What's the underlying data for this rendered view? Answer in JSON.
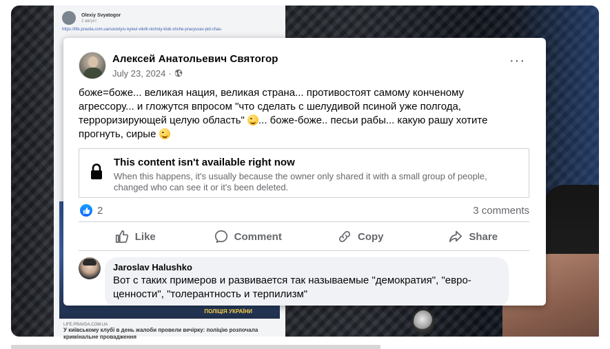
{
  "background": {
    "author": "Olexiy Svyatogor",
    "date": "2 август",
    "link": "https://life.pravda.com.ua/society/u-kyievi-vikrili-nichniy-klub-shche-pracyuvav-pid-chas-",
    "image_badge": "ПОЛІЦІЯ УКРАЇНИ",
    "source": "LIFE.PRAVDA.COM.UA",
    "caption": "У київському клубі в день жалоби провели вечірку: поліцію розпочала кримінальне провадження"
  },
  "post": {
    "author_name": "Алексей Анатольевич Святогор",
    "date": "July 23, 2024",
    "more_icon": "···",
    "text_part1": "боже=боже... великая нация, великая страна... противостоят самому конченому агрессору... и гложутся впросом \"что сделать с шелудивой псиной уже полгода, терроризирующей целую область\" ",
    "text_part2": "... боже-боже.. песьи рабы... какую рашу хотите прогнуть, сирые ",
    "unavailable_title": "This content isn't available right now",
    "unavailable_desc": "When this happens, it's usually because the owner only shared it with a small group of people, changed who can see it or it's been deleted.",
    "reaction_count": "2",
    "comments_count": "3 comments"
  },
  "actions": {
    "like": "Like",
    "comment": "Comment",
    "copy": "Copy",
    "share": "Share"
  },
  "comment": {
    "author": "Jaroslav Halushko",
    "text": "Вот с таких примеров и развивается так называемые \"демократия\", \"евро-ценности\", \"толерантность и терпилизм\""
  },
  "colors": {
    "facebook_blue": "#0866ff",
    "secondary_text": "#65676b",
    "comment_bg": "#f0f2f5"
  }
}
